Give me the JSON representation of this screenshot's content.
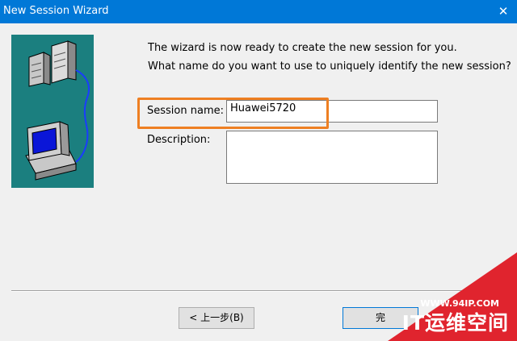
{
  "window": {
    "title": "New Session Wizard",
    "close_glyph": "✕"
  },
  "wizard": {
    "line1": "The wizard is now ready to create the new session for you.",
    "line2": "What name do you want to use to uniquely identify the new session?",
    "session_name_label": "Session name:",
    "session_name_value": "Huawei5720",
    "description_label": "Description:",
    "description_value": ""
  },
  "buttons": {
    "back_label": "< 上一步(B)",
    "finish_label": "完"
  },
  "watermark": {
    "url": "WWW.94IP.COM",
    "name": "IT运维空间"
  },
  "colors": {
    "titlebar": "#0078d7",
    "illustration_bg": "#1b7f7f",
    "highlight": "#ee7f22",
    "watermark": "#e0242e"
  },
  "icons": [
    "server-icon",
    "computer-icon",
    "network-cable-icon",
    "close-icon"
  ]
}
